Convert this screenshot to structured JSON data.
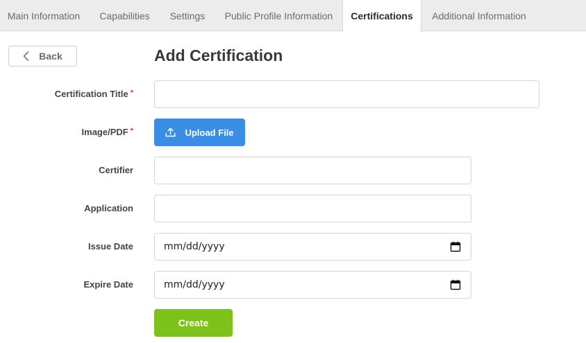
{
  "tabs": [
    {
      "label": "Main Information",
      "active": false
    },
    {
      "label": "Capabilities",
      "active": false
    },
    {
      "label": "Settings",
      "active": false
    },
    {
      "label": "Public Profile Information",
      "active": false
    },
    {
      "label": "Certifications",
      "active": true
    },
    {
      "label": "Additional Information",
      "active": false
    }
  ],
  "back_label": "Back",
  "page_title": "Add Certification",
  "form": {
    "certification_title": {
      "label": "Certification Title",
      "required_mark": "*",
      "value": ""
    },
    "image_pdf": {
      "label": "Image/PDF",
      "required_mark": "*",
      "button_label": "Upload File"
    },
    "certifier": {
      "label": "Certifier",
      "value": ""
    },
    "application": {
      "label": "Application",
      "value": ""
    },
    "issue_date": {
      "label": "Issue Date",
      "placeholder": "mm/dd/yyyy"
    },
    "expire_date": {
      "label": "Expire Date",
      "placeholder": "mm/dd/yyyy"
    }
  },
  "create_label": "Create",
  "colors": {
    "upload_button": "#3a8ee6",
    "create_button": "#7cc21a",
    "required_mark": "#e0313b",
    "tabbar_bg": "#ececec"
  },
  "icons": {
    "back": "chevron-left-icon",
    "upload": "upload-icon",
    "calendar": "calendar-icon"
  }
}
